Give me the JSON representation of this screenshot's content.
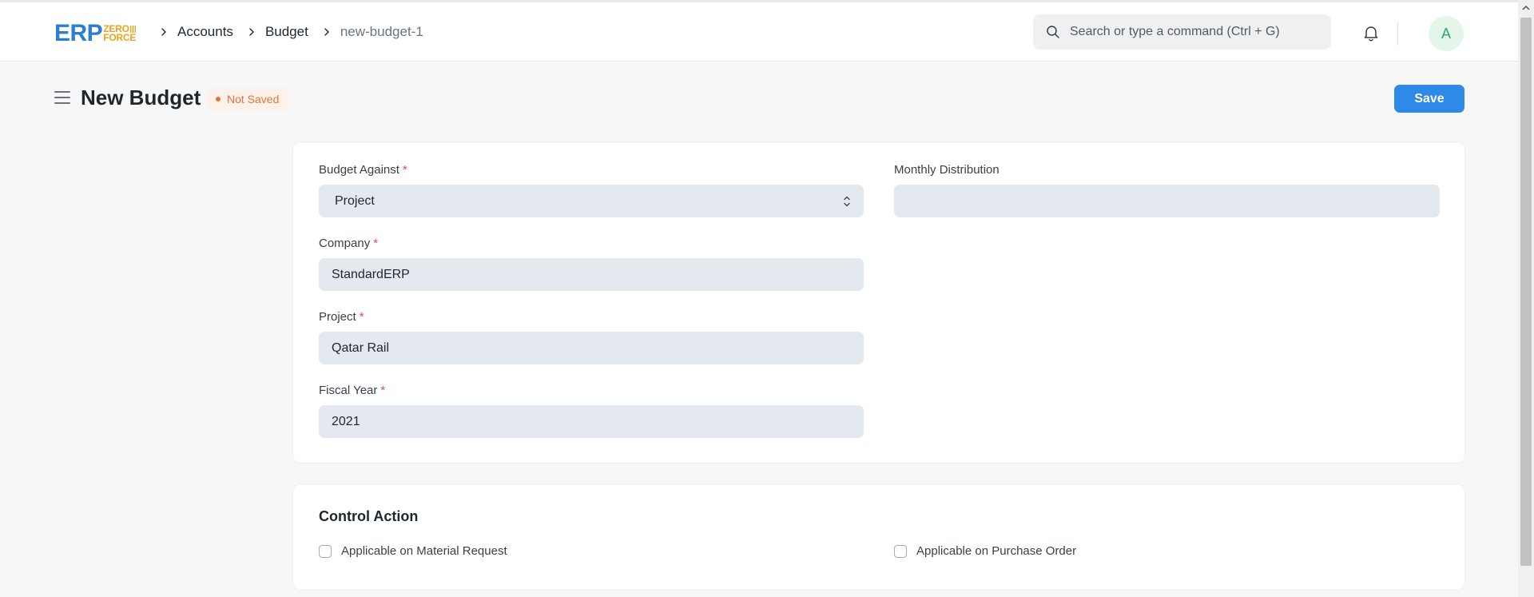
{
  "navbar": {
    "logo": {
      "main": "ERP",
      "sub_top": "ZERO",
      "sub_bottom": "FORCE"
    },
    "breadcrumbs": [
      "Accounts",
      "Budget",
      "new-budget-1"
    ],
    "search_placeholder": "Search or type a command (Ctrl + G)",
    "avatar_initial": "A"
  },
  "page": {
    "title": "New Budget",
    "status": "Not Saved",
    "save_label": "Save"
  },
  "form": {
    "budget_against": {
      "label": "Budget Against",
      "value": "Project"
    },
    "company": {
      "label": "Company",
      "value": "StandardERP"
    },
    "project": {
      "label": "Project",
      "value": "Qatar Rail"
    },
    "fiscal_year": {
      "label": "Fiscal Year",
      "value": "2021"
    },
    "monthly_distribution": {
      "label": "Monthly Distribution",
      "value": ""
    },
    "required_marker": "*"
  },
  "control_action": {
    "title": "Control Action",
    "material_request_label": "Applicable on Material Request",
    "purchase_order_label": "Applicable on Purchase Order"
  },
  "colors": {
    "primary": "#2f89e8",
    "logo_blue": "#2e7fcf",
    "logo_orange": "#f0a21b",
    "indicator_orange": "#e2753b",
    "required_red": "#e24c4c"
  }
}
